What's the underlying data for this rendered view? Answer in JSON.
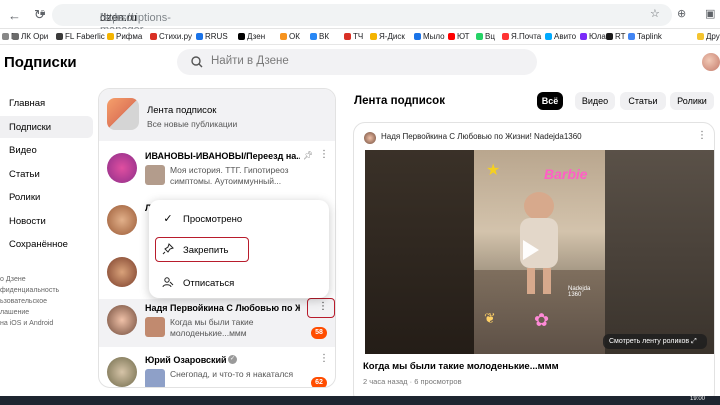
{
  "browser": {
    "url_protocol": "https://",
    "url_host": "dzen.ru",
    "url_path": "/subscriptions-manager",
    "bookmarks": [
      {
        "label": "Б",
        "color": "#888888"
      },
      {
        "label": "ЛК Ори",
        "color": "#6c6c6c"
      },
      {
        "label": "FL Faberlic",
        "color": "#3a3a3a"
      },
      {
        "label": "Рифма",
        "color": "#f4b400"
      },
      {
        "label": "Стихи.ру",
        "color": "#d93025"
      },
      {
        "label": "RRUS",
        "color": "#1a73e8"
      },
      {
        "label": "Дзен",
        "color": "#000000"
      },
      {
        "label": "ОК",
        "color": "#f7931e"
      },
      {
        "label": "ВК",
        "color": "#2787f5"
      },
      {
        "label": "ТЧ",
        "color": "#d93025"
      },
      {
        "label": "Я-Диск",
        "color": "#f4b400"
      },
      {
        "label": "Мыло",
        "color": "#1a73e8"
      },
      {
        "label": "ЮТ",
        "color": "#ff0000"
      },
      {
        "label": "Вц",
        "color": "#25d366"
      },
      {
        "label": "Я.Почта",
        "color": "#ff3333"
      },
      {
        "label": "Авито",
        "color": "#00aaff"
      },
      {
        "label": "Юла",
        "color": "#7b2bf9"
      },
      {
        "label": "RT",
        "color": "#1a1a1a"
      },
      {
        "label": "Taplink",
        "color": "#4285f4"
      },
      {
        "label": "Другие за",
        "color": "#f4c430"
      }
    ]
  },
  "header": {
    "title": "Подписки",
    "search_placeholder": "Найти в Дзене"
  },
  "sidebar": {
    "items": [
      {
        "label": "Главная",
        "active": false
      },
      {
        "label": "Подписки",
        "active": true
      },
      {
        "label": "Видео",
        "active": false
      },
      {
        "label": "Статьи",
        "active": false
      },
      {
        "label": "Ролики",
        "active": false
      },
      {
        "label": "Новости",
        "active": false
      },
      {
        "label": "Сохранённое",
        "active": false
      }
    ],
    "footer_links": [
      "о Дзене",
      "фиденциальность",
      "ьзовательское",
      "лашение",
      "на iOS и Android"
    ]
  },
  "subscriptions": {
    "feed_title": "Лента подписок",
    "feed_subtitle": "Все новые публикации",
    "channels": [
      {
        "name": "ИВАНОВЫ-ИВАНОВЫ/Переезд на...",
        "text": "Моя история. ТТГ. Гипотиреоз симптомы. Аутоиммунный...",
        "badge": ""
      },
      {
        "name": "Л",
        "text": "",
        "badge": ""
      },
      {
        "name": "",
        "text": "",
        "badge": ""
      },
      {
        "name": "Надя Первойкина С Любовью по Жи...",
        "text": "Когда мы были такие молоденькие...ммм",
        "badge": "58"
      },
      {
        "name": "Юрий Озаровский",
        "text": "Снегопад, и что-то я накатался",
        "badge": "62"
      }
    ]
  },
  "context_menu": {
    "items": [
      {
        "label": "Просмотрено",
        "icon": "check-icon"
      },
      {
        "label": "Закрепить",
        "icon": "pin-icon"
      },
      {
        "label": "Отписаться",
        "icon": "unsubscribe-icon"
      }
    ]
  },
  "feed": {
    "title": "Лента подписок",
    "filters": [
      {
        "label": "Всё",
        "active": true
      },
      {
        "label": "Видео",
        "active": false
      },
      {
        "label": "Статьи",
        "active": false
      },
      {
        "label": "Ролики",
        "active": false
      }
    ],
    "card": {
      "author": "Надя Первойкина С Любовью по Жизни! Nadejda1360",
      "video_overlay_text": "Barbie",
      "watermark": "Nadejda 1360",
      "watch_button": "Смотреть ленту роликов",
      "video_title": "Когда мы были такие молоденькие...ммм",
      "meta": "2 часа назад · 6 просмотров"
    }
  },
  "taskbar": {
    "time": "19:00"
  }
}
